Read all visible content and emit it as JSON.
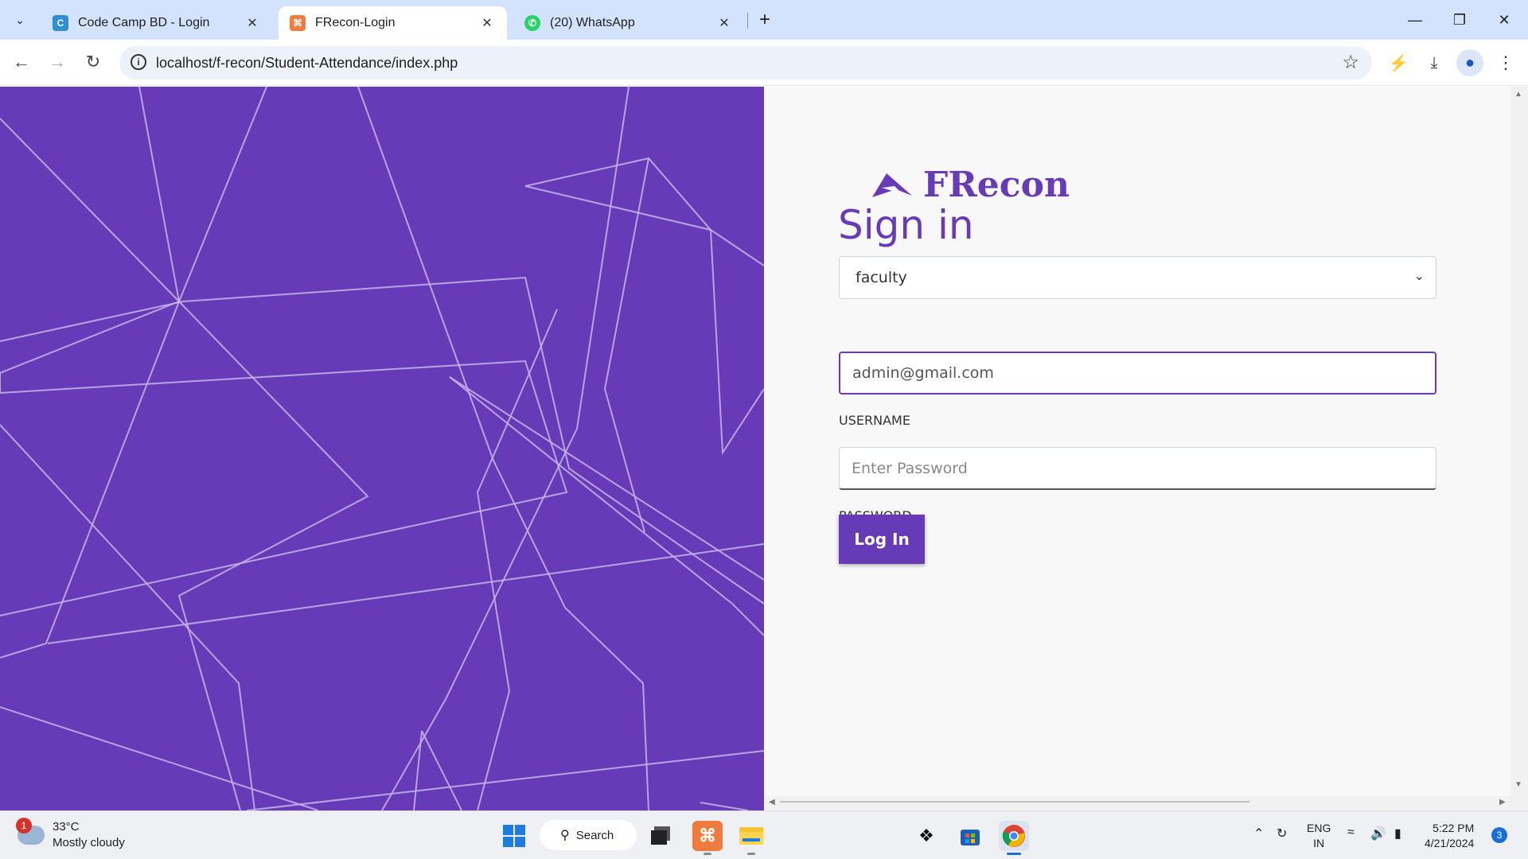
{
  "browser": {
    "tabs": [
      {
        "title": "Code Camp BD - Login",
        "favicon_color": "#2f8fcf",
        "favicon_glyph": "C"
      },
      {
        "title": "FRecon-Login",
        "favicon_color": "#f07b3f",
        "favicon_glyph": "⌘"
      },
      {
        "title": "(20) WhatsApp",
        "favicon_color": "#25d366",
        "favicon_glyph": "✆"
      }
    ],
    "url": "localhost/f-recon/Student-Attendance/index.php"
  },
  "login": {
    "brand": "FRecon",
    "heading": "Sign in",
    "role_selected": "faculty",
    "username_label": "USERNAME",
    "username_value": "admin@gmail.com",
    "password_label": "PASSWORD",
    "password_placeholder": "Enter Password",
    "login_button": "Log In",
    "accent_color": "#673bb7"
  },
  "taskbar": {
    "weather_badge": "1",
    "temperature": "33°C",
    "condition": "Mostly cloudy",
    "search_label": "Search",
    "lang_line1": "ENG",
    "lang_line2": "IN",
    "time": "5:22 PM",
    "date": "4/21/2024",
    "notification_count": "3"
  }
}
